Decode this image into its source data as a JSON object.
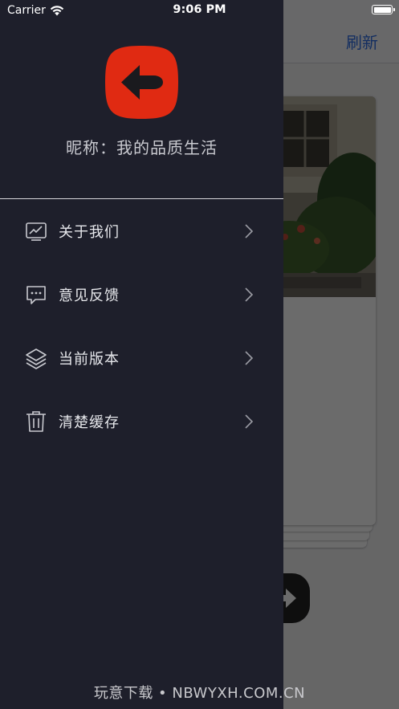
{
  "status_bar": {
    "carrier": "Carrier",
    "time": "9:06 PM"
  },
  "nav": {
    "refresh_label": "刷新"
  },
  "drawer": {
    "nickname": "昵称：我的品质生活",
    "avatar_icon": "back-arrow-icon",
    "items": [
      {
        "label": "关于我们",
        "icon": "chart-icon"
      },
      {
        "label": "意见反馈",
        "icon": "chat-bubble-icon"
      },
      {
        "label": "当前版本",
        "icon": "layers-icon"
      },
      {
        "label": "清楚缓存",
        "icon": "trash-icon"
      }
    ]
  },
  "watermark": "玩意下载 • NBWYXH.COM.CN",
  "colors": {
    "drawer_bg": "#1e1f2b",
    "avatar_red": "#e02a12",
    "accent_blue": "#2f6fe6"
  }
}
